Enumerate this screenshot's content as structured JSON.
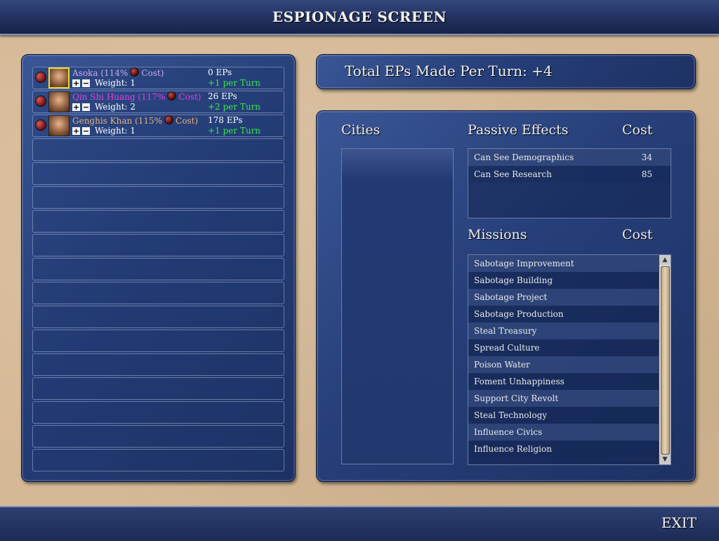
{
  "screen": {
    "title": "ESPIONAGE SCREEN",
    "exit_label": "EXIT"
  },
  "civs": [
    {
      "name": "Asoka",
      "cost_prefix": "(114%",
      "cost_suffix": "Cost)",
      "weight": "Weight: 1",
      "eps": "0 EPs",
      "per_turn": "+1 per Turn",
      "name_color": "#c9a8f0",
      "selected": true
    },
    {
      "name": "Qin Shi Huang",
      "cost_prefix": "(117%",
      "cost_suffix": "Cost)",
      "weight": "Weight: 2",
      "eps": "26 EPs",
      "per_turn": "+2 per Turn",
      "name_color": "#e23fe6",
      "selected": false
    },
    {
      "name": "Genghis Khan",
      "cost_prefix": "(115%",
      "cost_suffix": "Cost)",
      "weight": "Weight: 1",
      "eps": "178 EPs",
      "per_turn": "+1 per Turn",
      "name_color": "#e8b07a",
      "selected": false
    }
  ],
  "total": {
    "label": "Total EPs Made Per Turn: +4"
  },
  "headers": {
    "cities": "Cities",
    "passive": "Passive Effects",
    "missions": "Missions",
    "cost": "Cost"
  },
  "passive_effects": [
    {
      "name": "Can See Demographics",
      "cost": "34"
    },
    {
      "name": "Can See Research",
      "cost": "85"
    }
  ],
  "missions": [
    "Sabotage Improvement",
    "Sabotage Building",
    "Sabotage Project",
    "Sabotage Production",
    "Steal Treasury",
    "Spread Culture",
    "Poison Water",
    "Foment Unhappiness",
    "Support City Revolt",
    "Steal Technology",
    "Influence Civics",
    "Influence Religion"
  ],
  "icons": {
    "globe": "espionage-globe-icon",
    "plus": "plus-icon",
    "minus": "minus-icon",
    "scroll_up": "scroll-up-arrow-icon",
    "scroll_down": "scroll-down-arrow-icon"
  },
  "empty_rows": 14
}
